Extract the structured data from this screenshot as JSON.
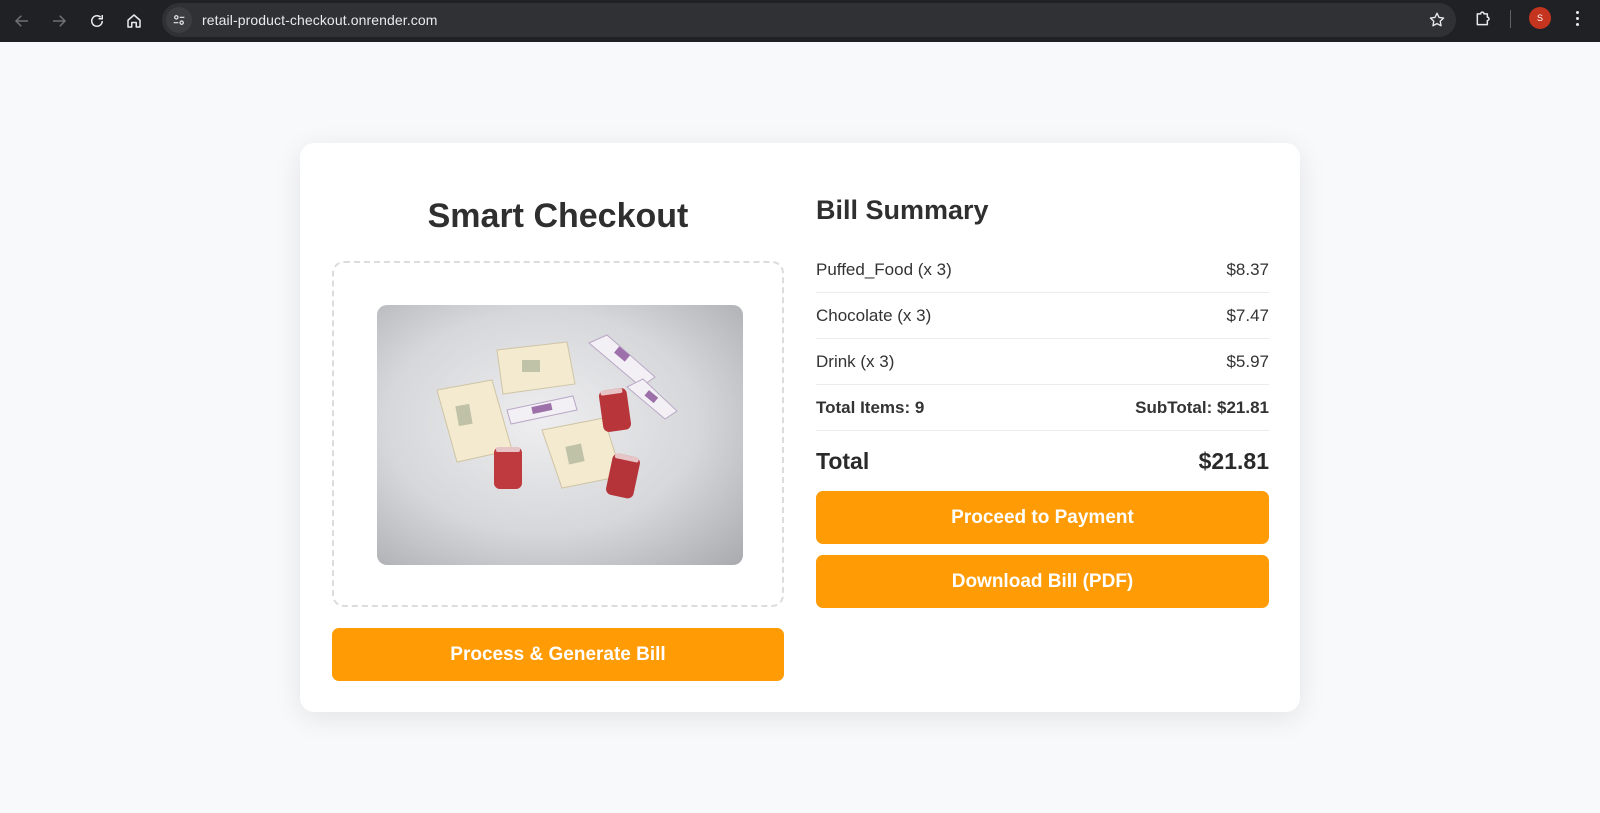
{
  "browser": {
    "url": "retail-product-checkout.onrender.com",
    "avatar_letter": "S"
  },
  "checkout": {
    "title": "Smart Checkout",
    "process_button": "Process & Generate Bill"
  },
  "summary": {
    "title": "Bill Summary",
    "items": [
      {
        "name": "Puffed_Food (x 3)",
        "price": "$8.37"
      },
      {
        "name": "Chocolate (x 3)",
        "price": "$7.47"
      },
      {
        "name": "Drink (x 3)",
        "price": "$5.97"
      }
    ],
    "total_items": "Total Items: 9",
    "subtotal": "SubTotal: $21.81",
    "total_label": "Total",
    "total_value": "$21.81",
    "pay_button": "Proceed to Payment",
    "pdf_button": "Download Bill (PDF)"
  },
  "colors": {
    "accent": "#ff9b05",
    "chrome": "#202124"
  }
}
